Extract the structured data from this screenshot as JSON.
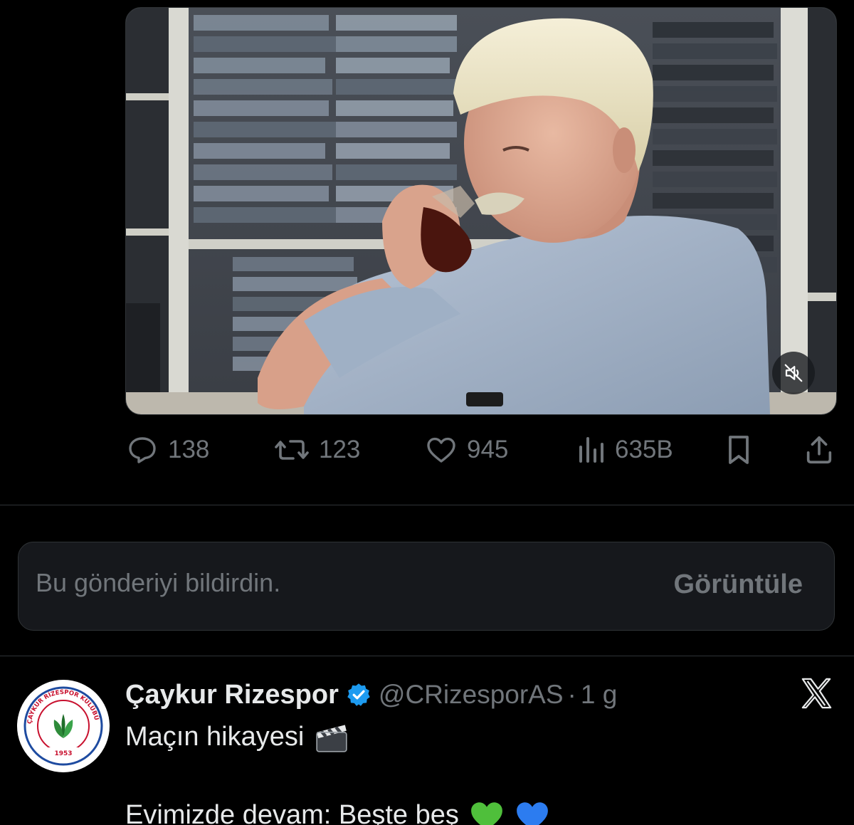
{
  "post": {
    "media": {
      "mute_icon": "speaker-muted-icon"
    },
    "actions": {
      "replies": "138",
      "reposts": "123",
      "likes": "945",
      "views": "635B",
      "icons": [
        "reply-icon",
        "repost-icon",
        "like-icon",
        "views-icon",
        "bookmark-icon",
        "share-icon"
      ]
    }
  },
  "reported_notice": {
    "text": "Bu gönderiyi bildirdin.",
    "view_label": "Görüntüle"
  },
  "next_tweet": {
    "author_name": "Çaykur Rizespor",
    "handle": "@CRizesporAS",
    "separator": "·",
    "time": "1 g",
    "avatar": {
      "ring_text": "ÇAYKUR RİZESPOR KULÜBÜ",
      "year": "1953"
    },
    "text_line1": "Maçın hikayesi",
    "text_line2": "Evimizde devam: Beşte beş",
    "emojis": [
      "clapper-board",
      "green-heart",
      "blue-heart"
    ]
  },
  "colors": {
    "background": "#000000",
    "muted_text": "#71767b",
    "primary_text": "#e7e9ea",
    "divider": "#2f3336",
    "verified_blue": "#1d9bf0",
    "club_red": "#c8102e",
    "club_blue": "#1e4ba0"
  }
}
